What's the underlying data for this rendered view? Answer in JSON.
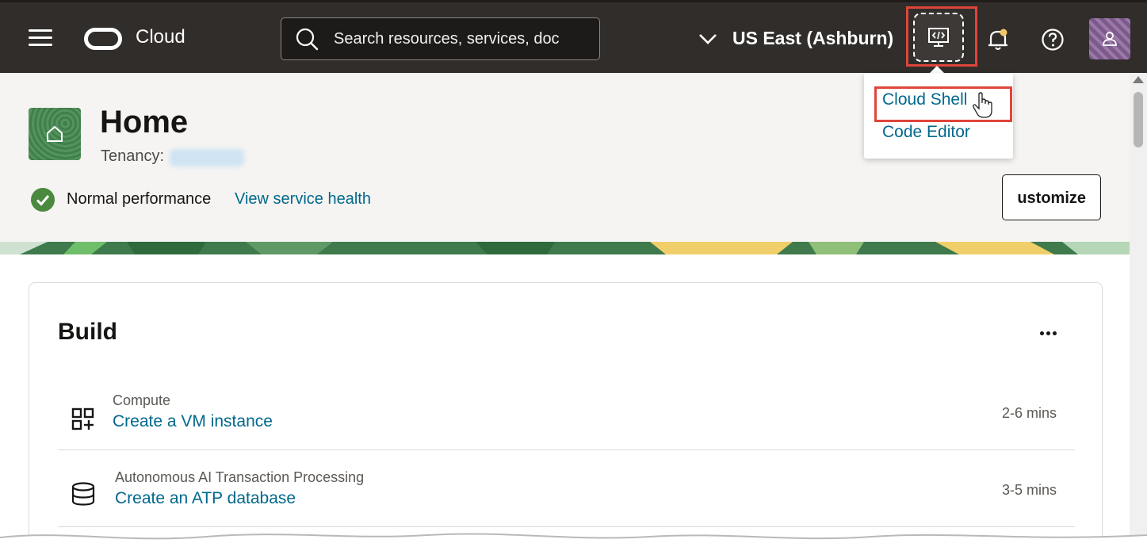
{
  "header": {
    "brand": "Cloud",
    "search": {
      "placeholder": "Search resources, services, doc"
    },
    "region": "US East (Ashburn)"
  },
  "dev_tools_menu": {
    "items": [
      "Cloud Shell",
      "Code Editor"
    ]
  },
  "page": {
    "title": "Home",
    "tenancy_label": "Tenancy:",
    "status": "Normal performance",
    "status_link": "View service health",
    "customize_label": "ustomize"
  },
  "build": {
    "title": "Build",
    "rows": [
      {
        "category": "Compute",
        "link": "Create a VM instance",
        "time": "2-6 mins",
        "icon": "compute-icon"
      },
      {
        "category": "Autonomous AI Transaction Processing",
        "link": "Create an ATP database",
        "time": "3-5 mins",
        "icon": "database-icon"
      }
    ]
  },
  "colors": {
    "header_bg": "#312d2a",
    "link": "#00688c",
    "highlight": "#e0453a",
    "success": "#4b8a3e"
  }
}
